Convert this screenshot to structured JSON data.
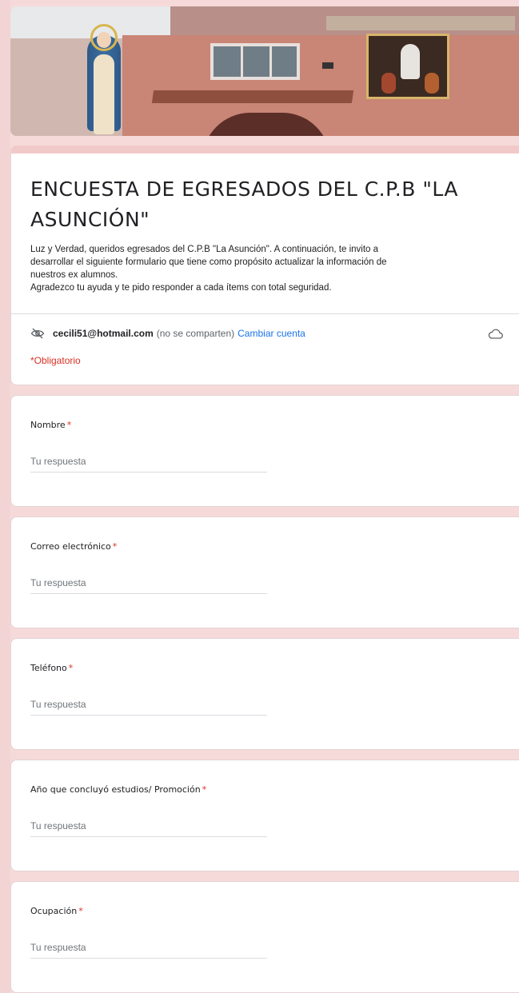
{
  "form": {
    "title": "ENCUESTA DE EGRESADOS DEL C.P.B \"LA ASUNCIÓN\"",
    "description_lines": [
      "Luz y Verdad, queridos egresados del C.P.B \"La Asunción\". A continuación, te invito a",
      "desarrollar el siguiente formulario que tiene como propósito actualizar la información de",
      "nuestros ex alumnos.",
      "Agradezco tu ayuda y te pido responder a cada ítems con total seguridad."
    ],
    "account": {
      "email": "cecili51@hotmail.com",
      "privacy_note": "(no se comparten)",
      "switch_label": "Cambiar cuenta",
      "hide_icon": "eye-off-icon",
      "save_icon": "cloud-icon"
    },
    "required_note": "*Obligatorio"
  },
  "questions": [
    {
      "label": "Nombre",
      "required_mark": "*",
      "placeholder": "Tu respuesta"
    },
    {
      "label": "Correo electrónico",
      "required_mark": "*",
      "placeholder": "Tu respuesta"
    },
    {
      "label": "Teléfono",
      "required_mark": "*",
      "placeholder": "Tu respuesta"
    },
    {
      "label": "Año que concluyó estudios/ Promoción",
      "required_mark": "*",
      "placeholder": "Tu respuesta"
    },
    {
      "label": "Ocupación",
      "required_mark": "*",
      "placeholder": "Tu respuesta"
    }
  ],
  "colors": {
    "background": "#f6dada",
    "accent_border": "#f2c9c9",
    "required": "#d93025",
    "link": "#1a73e8"
  }
}
